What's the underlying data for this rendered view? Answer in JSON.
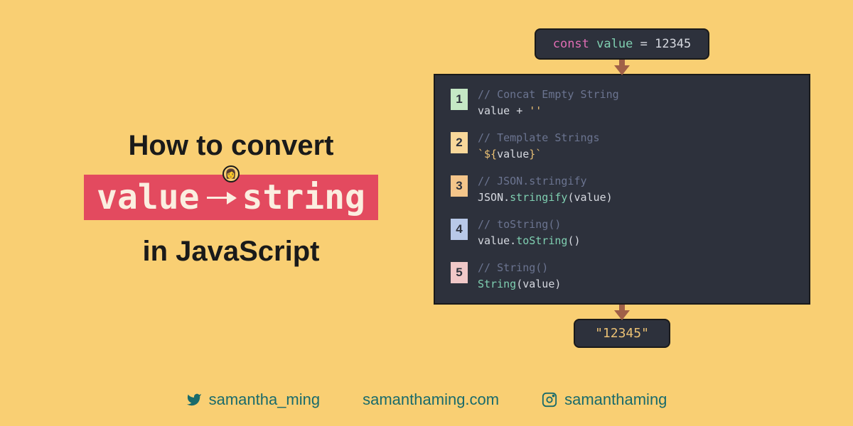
{
  "title": {
    "line1": "How to convert",
    "badge_from": "value",
    "badge_to": "string",
    "line2": "in JavaScript"
  },
  "declaration": {
    "keyword": "const",
    "variable": "value",
    "equals": "=",
    "number": "12345"
  },
  "methods": [
    {
      "num": "1",
      "comment": "// Concat Empty String",
      "code_html": "<span class='kw-plain'>value </span><span class='kw-eq'>+</span><span class='kw-str'> ''</span>"
    },
    {
      "num": "2",
      "comment": "// Template Strings",
      "code_html": "<span class='kw-str'>`${</span><span class='kw-plain'>value</span><span class='kw-str'>}`</span>"
    },
    {
      "num": "3",
      "comment": "// JSON.stringify",
      "code_html": "<span class='kw-plain'>JSON.</span><span class='kw-fn'>stringify</span><span class='kw-plain'>(value)</span>"
    },
    {
      "num": "4",
      "comment": "// toString()",
      "code_html": "<span class='kw-plain'>value.</span><span class='kw-fn'>toString</span><span class='kw-plain'>()</span>"
    },
    {
      "num": "5",
      "comment": "// String()",
      "code_html": "<span class='kw-fn'>String</span><span class='kw-plain'>(value)</span>"
    }
  ],
  "output": "\"12345\"",
  "social": {
    "twitter": "samantha_ming",
    "website": "samanthaming.com",
    "instagram": "samanthaming"
  }
}
